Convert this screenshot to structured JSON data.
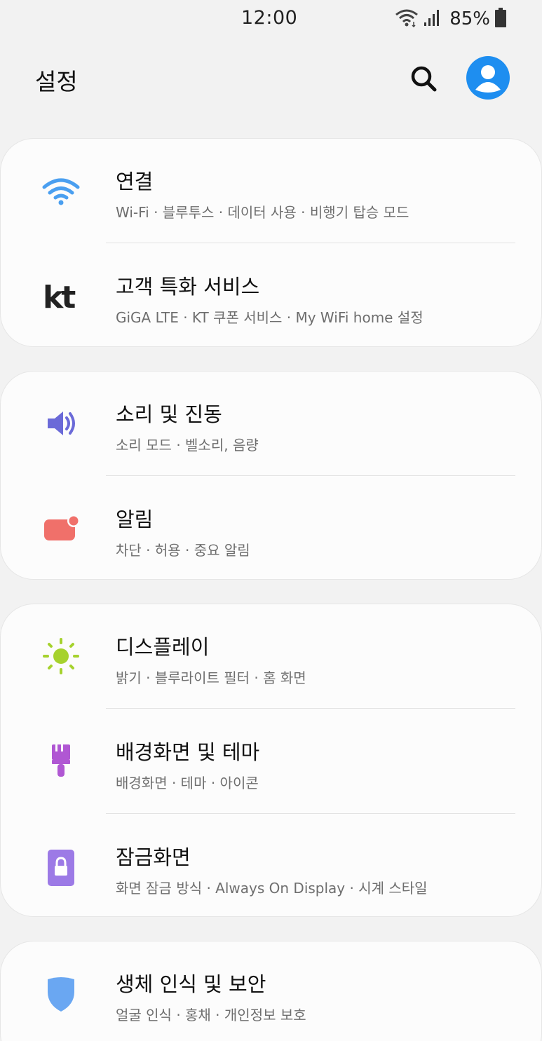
{
  "status_bar": {
    "time": "12:00",
    "battery": "85%",
    "icons": [
      "wifi-icon",
      "signal-icon",
      "battery-icon"
    ]
  },
  "header": {
    "title": "설정",
    "search_icon": "search-icon",
    "profile_icon": "avatar-icon"
  },
  "colors": {
    "background": "#f2f2f2",
    "card": "#fcfcfc",
    "profile": "#1e8ef0",
    "wifi": "#4a9ff0",
    "kt": "#222222",
    "sound": "#6b6ad8",
    "notification": "#f0706a",
    "display": "#a6d22e",
    "theme": "#b057d3",
    "lock": "#9c7ae6",
    "security": "#6aa7f2"
  },
  "groups": [
    {
      "items": [
        {
          "icon": "wifi-icon",
          "title": "연결",
          "subtitle": "Wi-Fi · 블루투스 · 데이터 사용 · 비행기 탑승 모드"
        },
        {
          "icon": "kt-logo-icon",
          "title": "고객 특화 서비스",
          "subtitle": "GiGA LTE · KT 쿠폰 서비스 · My WiFi home 설정"
        }
      ]
    },
    {
      "items": [
        {
          "icon": "speaker-icon",
          "title": "소리 및 진동",
          "subtitle": "소리 모드 · 벨소리, 음량"
        },
        {
          "icon": "notification-icon",
          "title": "알림",
          "subtitle": "차단 · 허용 · 중요 알림"
        }
      ]
    },
    {
      "items": [
        {
          "icon": "sun-icon",
          "title": "디스플레이",
          "subtitle": "밝기 · 블루라이트 필터 · 홈 화면"
        },
        {
          "icon": "paintbrush-icon",
          "title": "배경화면 및 테마",
          "subtitle": "배경화면 · 테마 · 아이콘"
        },
        {
          "icon": "lock-icon",
          "title": "잠금화면",
          "subtitle": "화면 잠금 방식 · Always On Display · 시계 스타일"
        }
      ]
    },
    {
      "items": [
        {
          "icon": "shield-icon",
          "title": "생체 인식 및 보안",
          "subtitle": "얼굴 인식 · 홍채 · 개인정보 보호"
        }
      ]
    }
  ]
}
